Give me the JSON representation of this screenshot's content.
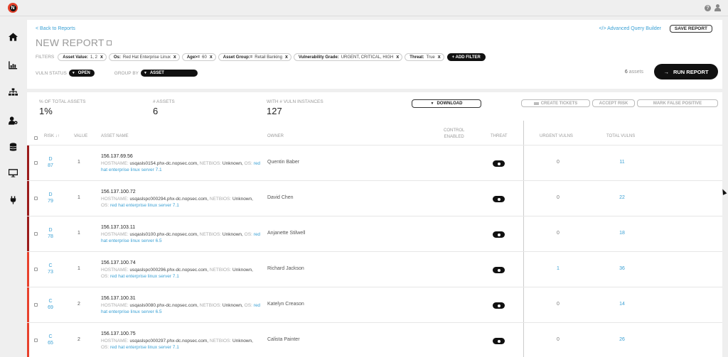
{
  "app": {
    "logo_letter": "N",
    "help_icon": "question-circle-icon",
    "user_icon": "user-icon"
  },
  "sidebar": {
    "items": [
      {
        "name": "home",
        "icon": "home-icon"
      },
      {
        "name": "reports",
        "icon": "bar-chart-icon"
      },
      {
        "name": "hierarchy",
        "icon": "sitemap-icon"
      },
      {
        "name": "users",
        "icon": "user-gear-icon"
      },
      {
        "name": "database",
        "icon": "database-icon"
      },
      {
        "name": "devices",
        "icon": "monitor-icon"
      },
      {
        "name": "integrations",
        "icon": "plug-icon"
      }
    ]
  },
  "header": {
    "back_link": "< Back to Reports",
    "title": "NEW REPORT",
    "advanced_query": "</> Advanced Query Builder",
    "save_report": "SAVE REPORT"
  },
  "filters": {
    "label": "FILTERS",
    "chips": [
      {
        "key": "Asset Value:",
        "value": "1, 2"
      },
      {
        "key": "Os:",
        "value": "Red Hat Enterprise Linux"
      },
      {
        "key": "Age>=",
        "value": "60"
      },
      {
        "key": "Asset Group:=",
        "value": "Retail Banking"
      },
      {
        "key": "Vulnerability Grade:",
        "value": "URGENT, CRITICAL, HIGH"
      },
      {
        "key": "Threat:",
        "value": "True"
      }
    ],
    "remove_glyph": "x",
    "add_filter": "+ ADD FILTER"
  },
  "controls": {
    "vuln_status_label": "VULN STATUS",
    "vuln_status_value": "OPEN",
    "group_by_label": "GROUP BY",
    "group_by_value": "ASSET",
    "asset_count_number": "6",
    "asset_count_suffix": "assets",
    "run_report": "RUN REPORT"
  },
  "stats": [
    {
      "label": "% OF TOTAL ASSETS",
      "value": "1%"
    },
    {
      "label": "# ASSETS",
      "value": "6"
    },
    {
      "label": "WITH # VULN INSTANCES",
      "value": "127"
    }
  ],
  "actions": {
    "download": "DOWNLOAD",
    "create_tickets": "CREATE TICKETS",
    "accept_risk": "ACCEPT RISK",
    "mark_false_positive": "MARK FALSE POSITIVE"
  },
  "table": {
    "columns": {
      "risk": "RISK ↓↑",
      "value": "VALUE",
      "asset_name": "ASSET NAME",
      "owner": "OWNER",
      "control_enabled_1": "CONTROL",
      "control_enabled_2": "ENABLED",
      "threat": "THREAT",
      "urgent_vulns": "URGENT VULNS",
      "total_vulns": "TOTAL VULNS"
    },
    "labels": {
      "hostname": "HOSTNAME:",
      "netbios": "NETBIOS:",
      "os": "OS:"
    },
    "grade_colors": {
      "D": "#9b1c1c",
      "C": "#e8412c"
    },
    "rows": [
      {
        "grade": "D",
        "score": "87",
        "value": "1",
        "ip": "156.137.69.56",
        "hostname": "usqasls0154.phx-dc.nopsec.com,",
        "netbios": "Unknown,",
        "os": "red hat enterprise linux server 7.1",
        "owner": "Quentin Baber",
        "threat": true,
        "urgent": "0",
        "total": "11"
      },
      {
        "grade": "D",
        "score": "79",
        "value": "1",
        "ip": "156.137.100.72",
        "hostname": "usqaslspc000294.phx-dc.nopsec.com,",
        "netbios": "Unknown,",
        "os": "red hat enterprise linux server 7.1",
        "owner": "David Chen",
        "threat": true,
        "urgent": "0",
        "total": "22"
      },
      {
        "grade": "D",
        "score": "78",
        "value": "1",
        "ip": "156.137.103.11",
        "hostname": "usqasls0100.phx-dc.nopsec.com,",
        "netbios": "Unknown,",
        "os": "red hat enterprise linux server 6.5",
        "owner": "Anjanette Stilwell",
        "threat": true,
        "urgent": "0",
        "total": "18"
      },
      {
        "grade": "C",
        "score": "73",
        "value": "1",
        "ip": "156.137.100.74",
        "hostname": "usqaslspc000296.phx-dc.nopsec.com,",
        "netbios": "Unknown,",
        "os": "red hat enterprise linux server 7.1",
        "owner": "Richard Jackson",
        "threat": true,
        "urgent": "1",
        "total": "36"
      },
      {
        "grade": "C",
        "score": "69",
        "value": "2",
        "ip": "156.137.100.31",
        "hostname": "usqasls0080.phx-dc.nopsec.com,",
        "netbios": "Unknown,",
        "os": "red hat enterprise linux server 6.5",
        "owner": "Katelyn Creason",
        "threat": true,
        "urgent": "0",
        "total": "14"
      },
      {
        "grade": "C",
        "score": "65",
        "value": "2",
        "ip": "156.137.100.75",
        "hostname": "usqaslspc000297.phx-dc.nopsec.com,",
        "netbios": "Unknown,",
        "os": "red hat enterprise linux server 7.1",
        "owner": "Calista Painter",
        "threat": true,
        "urgent": "0",
        "total": "26"
      }
    ]
  }
}
